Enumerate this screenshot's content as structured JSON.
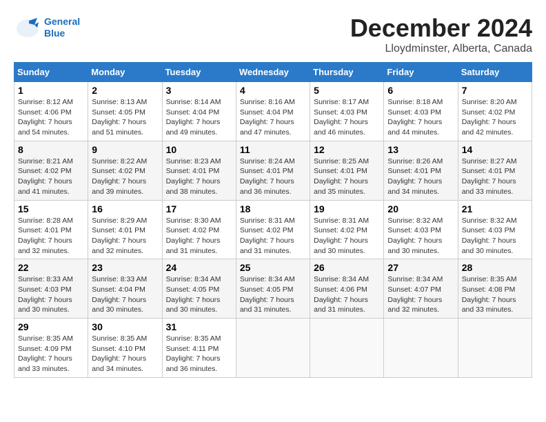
{
  "header": {
    "logo_line1": "General",
    "logo_line2": "Blue",
    "month_title": "December 2024",
    "location": "Lloydminster, Alberta, Canada"
  },
  "days_of_week": [
    "Sunday",
    "Monday",
    "Tuesday",
    "Wednesday",
    "Thursday",
    "Friday",
    "Saturday"
  ],
  "weeks": [
    [
      {
        "day": "1",
        "sunrise": "8:12 AM",
        "sunset": "4:06 PM",
        "daylight": "7 hours and 54 minutes."
      },
      {
        "day": "2",
        "sunrise": "8:13 AM",
        "sunset": "4:05 PM",
        "daylight": "7 hours and 51 minutes."
      },
      {
        "day": "3",
        "sunrise": "8:14 AM",
        "sunset": "4:04 PM",
        "daylight": "7 hours and 49 minutes."
      },
      {
        "day": "4",
        "sunrise": "8:16 AM",
        "sunset": "4:04 PM",
        "daylight": "7 hours and 47 minutes."
      },
      {
        "day": "5",
        "sunrise": "8:17 AM",
        "sunset": "4:03 PM",
        "daylight": "7 hours and 46 minutes."
      },
      {
        "day": "6",
        "sunrise": "8:18 AM",
        "sunset": "4:03 PM",
        "daylight": "7 hours and 44 minutes."
      },
      {
        "day": "7",
        "sunrise": "8:20 AM",
        "sunset": "4:02 PM",
        "daylight": "7 hours and 42 minutes."
      }
    ],
    [
      {
        "day": "8",
        "sunrise": "8:21 AM",
        "sunset": "4:02 PM",
        "daylight": "7 hours and 41 minutes."
      },
      {
        "day": "9",
        "sunrise": "8:22 AM",
        "sunset": "4:02 PM",
        "daylight": "7 hours and 39 minutes."
      },
      {
        "day": "10",
        "sunrise": "8:23 AM",
        "sunset": "4:01 PM",
        "daylight": "7 hours and 38 minutes."
      },
      {
        "day": "11",
        "sunrise": "8:24 AM",
        "sunset": "4:01 PM",
        "daylight": "7 hours and 36 minutes."
      },
      {
        "day": "12",
        "sunrise": "8:25 AM",
        "sunset": "4:01 PM",
        "daylight": "7 hours and 35 minutes."
      },
      {
        "day": "13",
        "sunrise": "8:26 AM",
        "sunset": "4:01 PM",
        "daylight": "7 hours and 34 minutes."
      },
      {
        "day": "14",
        "sunrise": "8:27 AM",
        "sunset": "4:01 PM",
        "daylight": "7 hours and 33 minutes."
      }
    ],
    [
      {
        "day": "15",
        "sunrise": "8:28 AM",
        "sunset": "4:01 PM",
        "daylight": "7 hours and 32 minutes."
      },
      {
        "day": "16",
        "sunrise": "8:29 AM",
        "sunset": "4:01 PM",
        "daylight": "7 hours and 32 minutes."
      },
      {
        "day": "17",
        "sunrise": "8:30 AM",
        "sunset": "4:02 PM",
        "daylight": "7 hours and 31 minutes."
      },
      {
        "day": "18",
        "sunrise": "8:31 AM",
        "sunset": "4:02 PM",
        "daylight": "7 hours and 31 minutes."
      },
      {
        "day": "19",
        "sunrise": "8:31 AM",
        "sunset": "4:02 PM",
        "daylight": "7 hours and 30 minutes."
      },
      {
        "day": "20",
        "sunrise": "8:32 AM",
        "sunset": "4:03 PM",
        "daylight": "7 hours and 30 minutes."
      },
      {
        "day": "21",
        "sunrise": "8:32 AM",
        "sunset": "4:03 PM",
        "daylight": "7 hours and 30 minutes."
      }
    ],
    [
      {
        "day": "22",
        "sunrise": "8:33 AM",
        "sunset": "4:03 PM",
        "daylight": "7 hours and 30 minutes."
      },
      {
        "day": "23",
        "sunrise": "8:33 AM",
        "sunset": "4:04 PM",
        "daylight": "7 hours and 30 minutes."
      },
      {
        "day": "24",
        "sunrise": "8:34 AM",
        "sunset": "4:05 PM",
        "daylight": "7 hours and 30 minutes."
      },
      {
        "day": "25",
        "sunrise": "8:34 AM",
        "sunset": "4:05 PM",
        "daylight": "7 hours and 31 minutes."
      },
      {
        "day": "26",
        "sunrise": "8:34 AM",
        "sunset": "4:06 PM",
        "daylight": "7 hours and 31 minutes."
      },
      {
        "day": "27",
        "sunrise": "8:34 AM",
        "sunset": "4:07 PM",
        "daylight": "7 hours and 32 minutes."
      },
      {
        "day": "28",
        "sunrise": "8:35 AM",
        "sunset": "4:08 PM",
        "daylight": "7 hours and 33 minutes."
      }
    ],
    [
      {
        "day": "29",
        "sunrise": "8:35 AM",
        "sunset": "4:09 PM",
        "daylight": "7 hours and 33 minutes."
      },
      {
        "day": "30",
        "sunrise": "8:35 AM",
        "sunset": "4:10 PM",
        "daylight": "7 hours and 34 minutes."
      },
      {
        "day": "31",
        "sunrise": "8:35 AM",
        "sunset": "4:11 PM",
        "daylight": "7 hours and 36 minutes."
      },
      null,
      null,
      null,
      null
    ]
  ]
}
